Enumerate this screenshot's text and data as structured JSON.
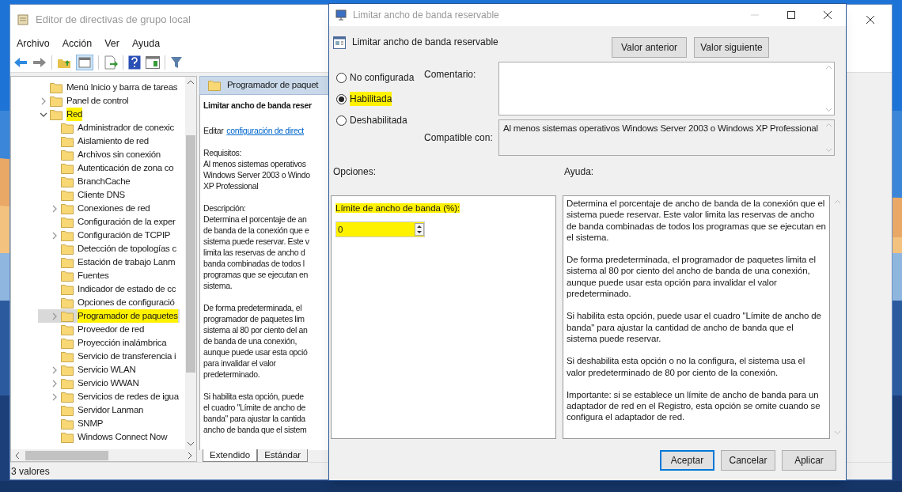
{
  "main_window": {
    "title": "Editor de directivas de grupo local",
    "menu": [
      "Archivo",
      "Acción",
      "Ver",
      "Ayuda"
    ],
    "tree": [
      {
        "label": "Menú Inicio y barra de tareas",
        "expandable": false,
        "selected": false,
        "highlighted": false
      },
      {
        "label": "Panel de control",
        "expandable": true,
        "selected": false,
        "highlighted": false
      },
      {
        "label": "Red",
        "expandable": true,
        "expanded": true,
        "selected": false,
        "highlighted": true,
        "children": [
          {
            "label": "Administrador de conexic",
            "expandable": false,
            "selected": false,
            "highlighted": false
          },
          {
            "label": "Aislamiento de red",
            "expandable": false,
            "selected": false,
            "highlighted": false
          },
          {
            "label": "Archivos sin conexión",
            "expandable": false,
            "selected": false,
            "highlighted": false
          },
          {
            "label": "Autenticación de zona co",
            "expandable": false,
            "selected": false,
            "highlighted": false
          },
          {
            "label": "BranchCache",
            "expandable": false,
            "selected": false,
            "highlighted": false
          },
          {
            "label": "Cliente DNS",
            "expandable": false,
            "selected": false,
            "highlighted": false
          },
          {
            "label": "Conexiones de red",
            "expandable": true,
            "selected": false,
            "highlighted": false
          },
          {
            "label": "Configuración de la exper",
            "expandable": false,
            "selected": false,
            "highlighted": false
          },
          {
            "label": "Configuración de TCPIP",
            "expandable": true,
            "selected": false,
            "highlighted": false
          },
          {
            "label": "Detección de topologías c",
            "expandable": false,
            "selected": false,
            "highlighted": false
          },
          {
            "label": "Estación de trabajo Lanm",
            "expandable": false,
            "selected": false,
            "highlighted": false
          },
          {
            "label": "Fuentes",
            "expandable": false,
            "selected": false,
            "highlighted": false
          },
          {
            "label": "Indicador de estado de cc",
            "expandable": false,
            "selected": false,
            "highlighted": false
          },
          {
            "label": "Opciones de configuració",
            "expandable": false,
            "selected": false,
            "highlighted": false
          },
          {
            "label": "Programador de paquetes",
            "expandable": true,
            "selected": true,
            "highlighted": true
          },
          {
            "label": "Proveedor de red",
            "expandable": false,
            "selected": false,
            "highlighted": false
          },
          {
            "label": "Proyección inalámbrica",
            "expandable": false,
            "selected": false,
            "highlighted": false
          },
          {
            "label": "Servicio de transferencia i",
            "expandable": false,
            "selected": false,
            "highlighted": false
          },
          {
            "label": "Servicio WLAN",
            "expandable": true,
            "selected": false,
            "highlighted": false
          },
          {
            "label": "Servicio WWAN",
            "expandable": true,
            "selected": false,
            "highlighted": false
          },
          {
            "label": "Servicios de redes de igua",
            "expandable": true,
            "selected": false,
            "highlighted": false
          },
          {
            "label": "Servidor Lanman",
            "expandable": false,
            "selected": false,
            "highlighted": false
          },
          {
            "label": "SNMP",
            "expandable": false,
            "selected": false,
            "highlighted": false
          },
          {
            "label": "Windows Connect Now",
            "expandable": false,
            "selected": false,
            "highlighted": false
          }
        ]
      }
    ],
    "details": {
      "header": "Programador de paquet",
      "policy_title": "Limitar ancho de banda reser",
      "edit_prefix": "Editar",
      "edit_link": "configuración de direct",
      "paragraphs": [
        [
          "Requisitos:",
          "Al menos sistemas operativos",
          "Windows Server 2003 o Windo",
          "XP Professional"
        ],
        [
          "Descripción:",
          "Determina el porcentaje de an",
          "de banda de la conexión que e",
          "sistema puede reservar. Este v",
          "limita las reservas de ancho d",
          "banda combinadas de todos l",
          "programas que se ejecutan en",
          "sistema."
        ],
        [
          "De forma predeterminada, el",
          "programador de paquetes lim",
          "sistema al 80 por ciento del an",
          "de banda de una conexión,",
          "aunque puede usar esta opció",
          "para invalidar el valor",
          "predeterminado."
        ],
        [
          "Si habilita esta opción, puede",
          "el cuadro \"Límite de ancho de",
          "banda\" para ajustar la cantida",
          "ancho de banda que el sistem"
        ]
      ]
    },
    "tabs": [
      {
        "label": "Extendido",
        "selected": true
      },
      {
        "label": "Estándar",
        "selected": false
      }
    ],
    "status_bar": "3 valores"
  },
  "dialog": {
    "title": "Limitar ancho de banda reservable",
    "heading": "Limitar ancho de banda reservable",
    "nav_buttons": [
      "Valor anterior",
      "Valor siguiente"
    ],
    "states": [
      {
        "label": "No configurada",
        "selected": false,
        "highlighted": false
      },
      {
        "label": "Habilitada",
        "selected": true,
        "highlighted": true
      },
      {
        "label": "Deshabilitada",
        "selected": false,
        "highlighted": false
      }
    ],
    "comment_label": "Comentario:",
    "compatible_label": "Compatible con:",
    "compatible_text": "Al menos sistemas operativos Windows Server 2003 o Windows XP Professional",
    "options_label": "Opciones:",
    "help_label": "Ayuda:",
    "option": {
      "label": "Límite de ancho de banda (%):",
      "value": "0",
      "highlighted": true
    },
    "help": [
      "Determina el porcentaje de ancho de banda de la conexión que el sistema puede reservar. Este valor limita las reservas de ancho de banda combinadas de todos los programas que se ejecutan en el sistema.",
      "De forma predeterminada, el programador de paquetes limita el sistema al 80 por ciento del ancho de banda de una conexión, aunque puede usar esta opción para invalidar el valor predeterminado.",
      "Si habilita esta opción, puede usar el cuadro \"Límite de ancho de banda\" para ajustar la cantidad de ancho de banda que el sistema puede reservar.",
      "Si deshabilita esta opción o no la configura, el sistema usa el valor predeterminado de 80 por ciento de la conexión.",
      "Importante: si se establece un límite de ancho de banda para un adaptador de red en el Registro, esta opción se omite cuando se configura el adaptador de red."
    ],
    "buttons": [
      {
        "label": "Aceptar",
        "default": true
      },
      {
        "label": "Cancelar",
        "default": false
      },
      {
        "label": "Aplicar",
        "default": false
      }
    ]
  }
}
